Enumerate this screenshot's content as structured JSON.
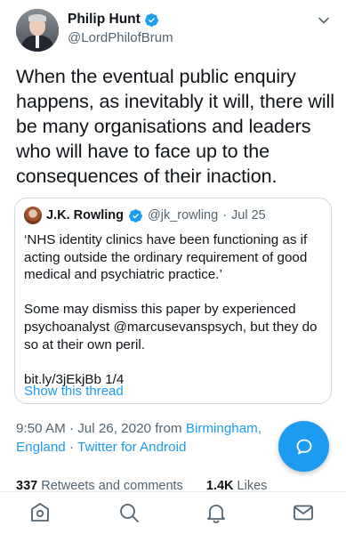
{
  "author": {
    "name": "Philip Hunt",
    "handle": "@LordPhilofBrum",
    "verified": true
  },
  "tweet": {
    "text": "When the eventual public enquiry happens, as inevitably it will, there will be many organisations and leaders who will have to face up to the consequences  of their inaction."
  },
  "quoted_tweet": {
    "name": "J.K. Rowling",
    "handle": "@jk_rowling",
    "separator": "·",
    "date": "Jul 25",
    "paragraphs": [
      "‘NHS identity clinics have been functioning as if acting outside the ordinary requirement of good medical and psychiatric practice.’",
      "Some may dismiss this paper by experienced psychoanalyst @marcusevanspsych, but they do so at their own peril.",
      "bit.ly/3jEkjBb 1/4"
    ],
    "show_thread": "Show this thread"
  },
  "meta": {
    "time_date": "9:50 AM · Jul 26, 2020 from",
    "location": "Birmingham, England",
    "separator": "·",
    "source": "Twitter for Android"
  },
  "stats": {
    "retweets_count": "337",
    "retweets_label": "Retweets and comments",
    "likes_count": "1.4K",
    "likes_label": "Likes"
  },
  "colors": {
    "accent": "#1d9bf0",
    "secondary_text": "#536471",
    "primary_text": "#0f1419",
    "border": "#cfd9de"
  },
  "icons": {
    "verified": "verified-badge-icon",
    "caret": "chevron-down-icon",
    "compose": "reply-bubble-icon",
    "tabs": [
      "home-icon",
      "search-icon",
      "notifications-icon",
      "messages-icon"
    ]
  }
}
